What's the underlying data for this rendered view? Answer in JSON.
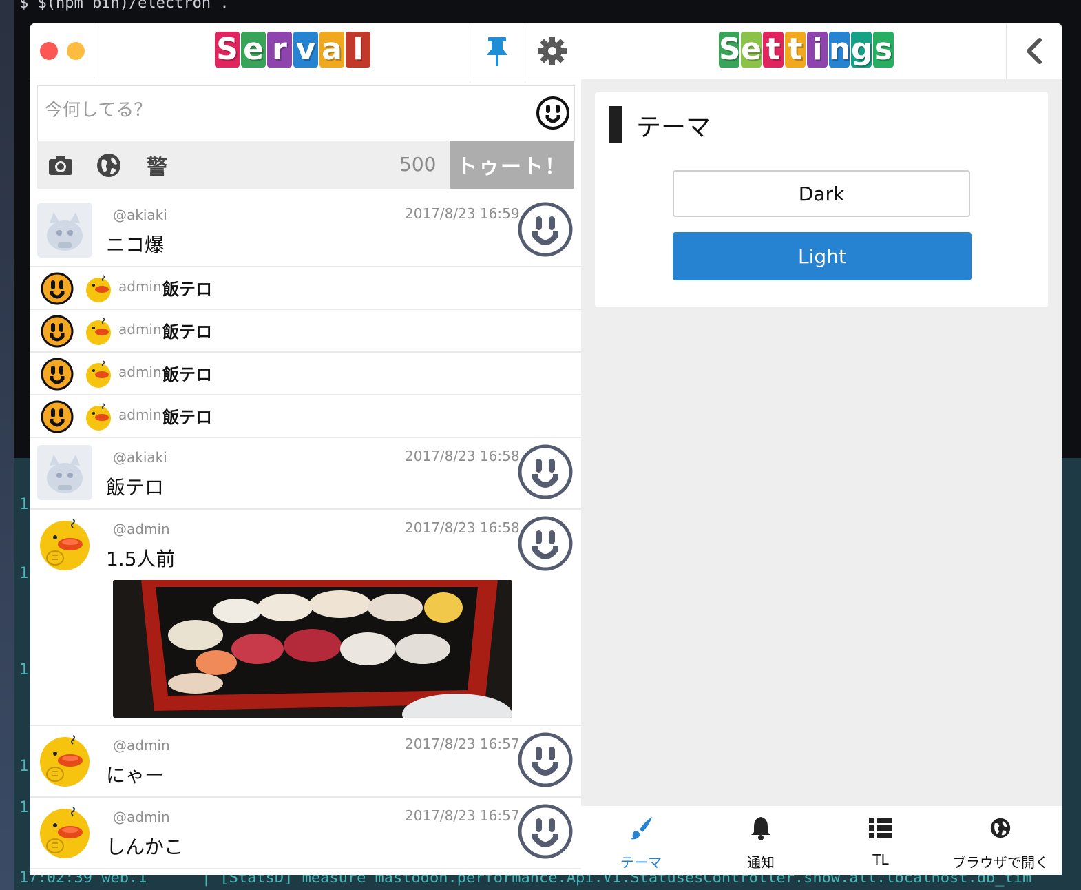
{
  "terminal": {
    "top_line": "$ $(npm bin)/electron .",
    "bottom_line": "17:02:39 web.1      | [StatsD] measure mastodon.performance.Api.V1.StatusesController.show.all.localhost.db_tim"
  },
  "app": {
    "title": "Serval",
    "settings_title": "Settings",
    "icons": {
      "pin": "pin-icon",
      "settings": "gear-icon",
      "back": "chevron-left-icon"
    }
  },
  "compose": {
    "placeholder": "今何してる？",
    "char_count": "500",
    "toot_label": "トゥート！",
    "icons": [
      "camera-icon",
      "globe-icon",
      "warning-kanji-icon"
    ],
    "cw_label": "警"
  },
  "timeline": [
    {
      "kind": "status",
      "acct": "@akiaki",
      "time": "2017/8/23 16:59",
      "content": "ニコ爆",
      "avatar": "cat-avatar"
    },
    {
      "kind": "notification",
      "who": "admin",
      "text": "飯テロ"
    },
    {
      "kind": "notification",
      "who": "admin",
      "text": "飯テロ"
    },
    {
      "kind": "notification",
      "who": "admin",
      "text": "飯テロ"
    },
    {
      "kind": "notification",
      "who": "admin",
      "text": "飯テロ"
    },
    {
      "kind": "status",
      "acct": "@akiaki",
      "time": "2017/8/23 16:58",
      "content": "飯テロ",
      "avatar": "cat-avatar"
    },
    {
      "kind": "status",
      "acct": "@admin",
      "time": "2017/8/23 16:58",
      "content": "1.5人前",
      "avatar": "duck-avatar",
      "media": "sushi-photo"
    },
    {
      "kind": "status",
      "acct": "@admin",
      "time": "2017/8/23 16:57",
      "content": "にゃー",
      "avatar": "duck-avatar"
    },
    {
      "kind": "status",
      "acct": "@admin",
      "time": "2017/8/23 16:57",
      "content": "しんかこ",
      "avatar": "duck-avatar"
    }
  ],
  "settings": {
    "section_title": "テーマ",
    "options": [
      "Dark",
      "Light"
    ],
    "selected": "Light"
  },
  "tabs": [
    {
      "label": "テーマ",
      "icon": "brush-icon",
      "active": true
    },
    {
      "label": "通知",
      "icon": "bell-icon",
      "active": false
    },
    {
      "label": "TL",
      "icon": "list-icon",
      "active": false
    },
    {
      "label": "ブラウザで開く",
      "icon": "globe-icon",
      "active": false
    }
  ],
  "colors": {
    "accent": "#2683d1",
    "toot_button": "#adadad",
    "favourite_ring": "#555c70",
    "notification_icon": "#f5a623"
  }
}
